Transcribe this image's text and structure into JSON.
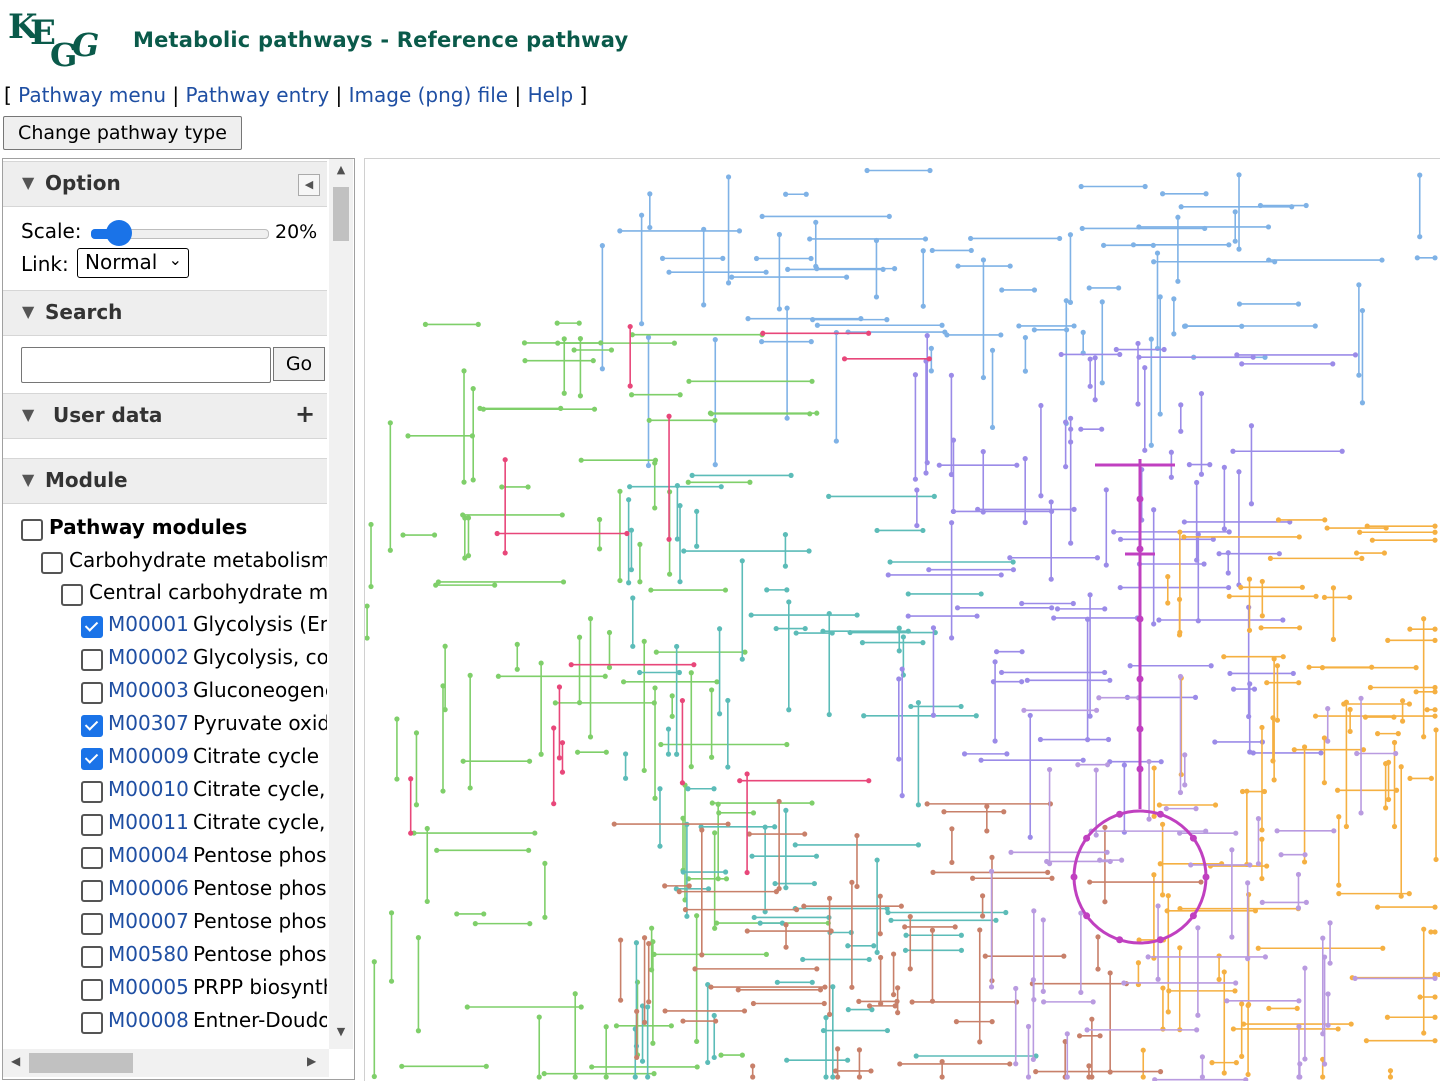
{
  "header": {
    "logo_text": "KEGG",
    "title": "Metabolic pathways - Reference pathway"
  },
  "nav": {
    "open_bracket": "[",
    "links": [
      "Pathway menu",
      "Pathway entry",
      "Image (png) file",
      "Help"
    ],
    "separator": "|",
    "close_bracket": "]"
  },
  "change_button": "Change pathway type",
  "panel": {
    "option": {
      "title": "Option",
      "scale_label": "Scale:",
      "scale_value": "20%",
      "scale_fraction": 0.2,
      "link_label": "Link:",
      "link_value": "Normal"
    },
    "search": {
      "title": "Search",
      "value": "",
      "button": "Go"
    },
    "user_data": {
      "title": "User data",
      "add": "+"
    },
    "module": {
      "title": "Module",
      "tree": [
        {
          "label": "Pathway modules",
          "checked": false
        },
        {
          "label": "Carbohydrate metabolism",
          "checked": false
        },
        {
          "label": "Central carbohydrate me",
          "checked": false
        }
      ],
      "modules": [
        {
          "id": "M00001",
          "name": "Glycolysis (En",
          "checked": true
        },
        {
          "id": "M00002",
          "name": "Glycolysis, co",
          "checked": false
        },
        {
          "id": "M00003",
          "name": "Gluconeogene",
          "checked": false
        },
        {
          "id": "M00307",
          "name": "Pyruvate oxid",
          "checked": true
        },
        {
          "id": "M00009",
          "name": "Citrate cycle (",
          "checked": true
        },
        {
          "id": "M00010",
          "name": "Citrate cycle,",
          "checked": false
        },
        {
          "id": "M00011",
          "name": "Citrate cycle,",
          "checked": false
        },
        {
          "id": "M00004",
          "name": "Pentose phos",
          "checked": false
        },
        {
          "id": "M00006",
          "name": "Pentose phos",
          "checked": false
        },
        {
          "id": "M00007",
          "name": "Pentose phos",
          "checked": false
        },
        {
          "id": "M00580",
          "name": "Pentose phos",
          "checked": false
        },
        {
          "id": "M00005",
          "name": "PRPP biosynth",
          "checked": false
        },
        {
          "id": "M00008",
          "name": "Entner-Doudo",
          "checked": false
        }
      ]
    }
  },
  "map": {
    "colors": {
      "blue": "#7fb2e6",
      "green": "#7fcf6a",
      "teal": "#5cbcb8",
      "purple": "#9b8be8",
      "orange": "#f5b042",
      "pink": "#e8477a",
      "magenta": "#c040c0",
      "brown": "#c8806a",
      "violet": "#b99be0"
    }
  }
}
